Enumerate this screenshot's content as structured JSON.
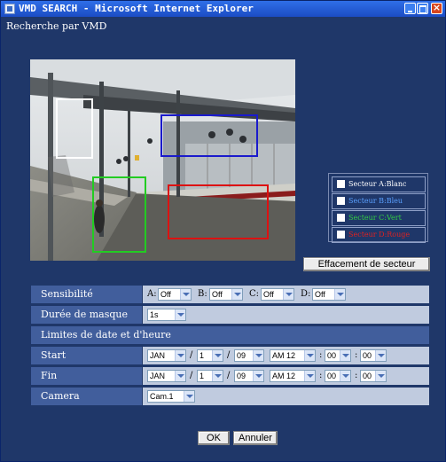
{
  "window": {
    "title": "VMD SEARCH - Microsoft Internet Explorer",
    "close_glyph": "×"
  },
  "page_title": "Recherche par VMD",
  "camera_view": {
    "image": "train-station-platform"
  },
  "sectors": [
    {
      "label": "Secteur A:Blanc",
      "color": "#ffffff"
    },
    {
      "label": "Secteur B:Bleu",
      "color": "#1a1acc"
    },
    {
      "label": "Secteur C:Vert",
      "color": "#22cc22"
    },
    {
      "label": "Secteur D:Rouge",
      "color": "#dd1111"
    }
  ],
  "clear_button": "Effacement de secteur",
  "form": {
    "sensitivity": {
      "label": "Sensibilité",
      "a_label": "A:",
      "a_value": "Off",
      "b_label": "B:",
      "b_value": "Off",
      "c_label": "C:",
      "c_value": "Off",
      "d_label": "D:",
      "d_value": "Off"
    },
    "mask_duration": {
      "label": "Durée de masque",
      "value": "1s"
    },
    "date_limits_header": "Limites de date et d'heure",
    "start": {
      "label": "Start",
      "month": "JAN",
      "day": "1",
      "year": "09",
      "hour": "AM 12",
      "minute": "00",
      "second": "00"
    },
    "end": {
      "label": "Fin",
      "month": "JAN",
      "day": "1",
      "year": "09",
      "hour": "AM 12",
      "minute": "00",
      "second": "00"
    },
    "camera": {
      "label": "Camera",
      "value": "Cam.1"
    },
    "separators": {
      "slash": "/",
      "colon": ":"
    }
  },
  "buttons": {
    "ok": "OK",
    "cancel": "Annuler"
  }
}
